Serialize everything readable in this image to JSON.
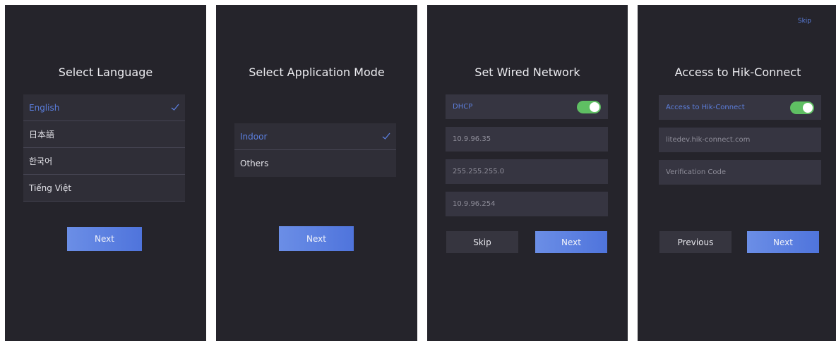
{
  "language_screen": {
    "title": "Select Language",
    "options": [
      "English",
      "日本語",
      "한국어",
      "Tiếng Việt"
    ],
    "selected_index": 0,
    "next_label": "Next"
  },
  "mode_screen": {
    "title": "Select Application Mode",
    "options": [
      "Indoor",
      "Others"
    ],
    "selected_index": 0,
    "next_label": "Next"
  },
  "network_screen": {
    "title": "Set Wired Network",
    "dhcp_label": "DHCP",
    "dhcp_enabled": true,
    "ip_address": "10.9.96.35",
    "subnet_mask": "255.255.255.0",
    "gateway": "10.9.96.254",
    "skip_label": "Skip",
    "next_label": "Next"
  },
  "hik_screen": {
    "skip_label": "Skip",
    "title": "Access to Hik-Connect",
    "toggle_label": "Access to Hik-Connect",
    "toggle_enabled": true,
    "server_address": "litedev.hik-connect.com",
    "verification_placeholder": "Verification Code",
    "previous_label": "Previous",
    "next_label": "Next"
  },
  "colors": {
    "panel_bg": "#25242b",
    "accent": "#5b7fdf",
    "toggle_on": "#5fbf63"
  }
}
